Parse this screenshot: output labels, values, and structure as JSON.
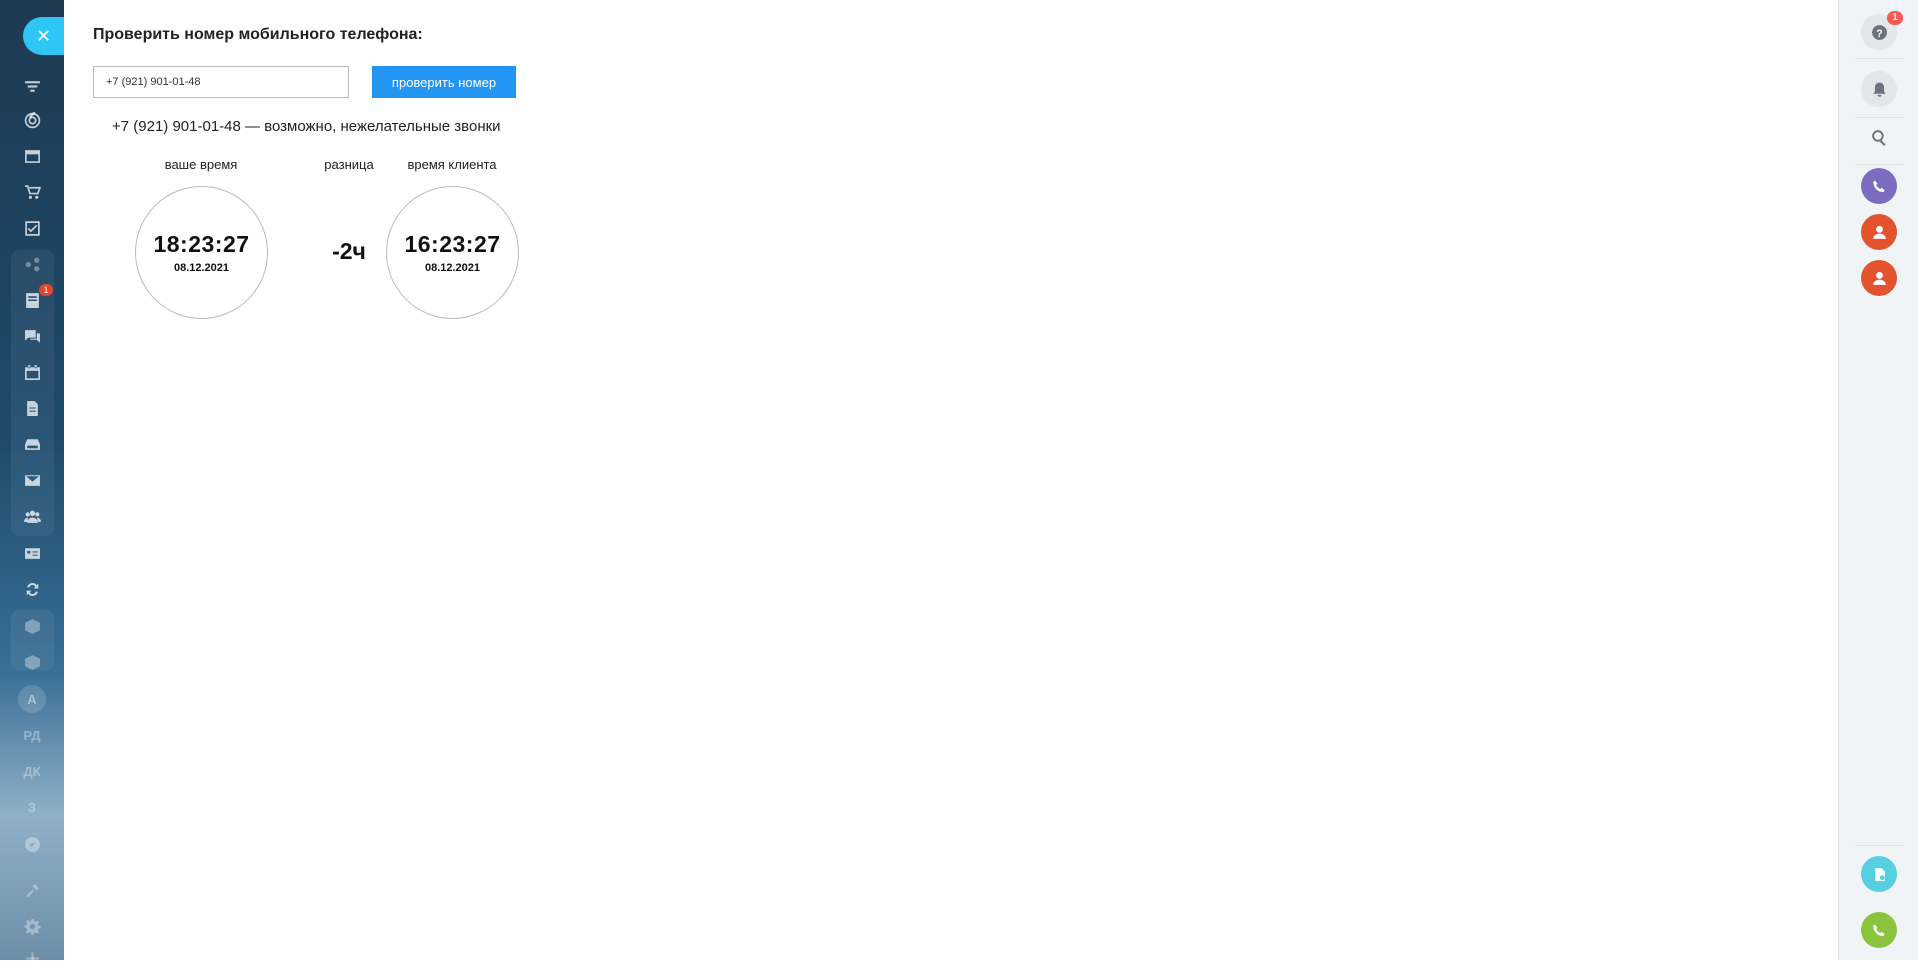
{
  "sidebar": {
    "close_icon": "close-icon",
    "items": [
      {
        "name": "filter-icon"
      },
      {
        "name": "target-icon"
      },
      {
        "name": "window-icon"
      },
      {
        "name": "cart-icon"
      },
      {
        "name": "task-icon"
      },
      {
        "name": "share-icon"
      },
      {
        "name": "feed-icon",
        "badge": "1"
      },
      {
        "name": "chat-icon"
      },
      {
        "name": "calendar-icon"
      },
      {
        "name": "document-icon"
      },
      {
        "name": "drive-icon"
      },
      {
        "name": "mail-icon"
      },
      {
        "name": "group-icon"
      },
      {
        "name": "contact-card-icon"
      },
      {
        "name": "sync-icon"
      },
      {
        "name": "box-icon"
      },
      {
        "name": "box-icon-2"
      },
      {
        "name": "text-a",
        "text": "А"
      },
      {
        "name": "text-rd",
        "text": "РД"
      },
      {
        "name": "text-dk",
        "text": "ДК"
      },
      {
        "name": "text-z",
        "text": "З"
      },
      {
        "name": "check-circle-icon"
      },
      {
        "name": "tools-icon"
      },
      {
        "name": "gear-icon"
      },
      {
        "name": "plus-icon"
      }
    ]
  },
  "main": {
    "title": "Проверить номер мобильного телефона:",
    "phone_value": "+7 (921) 901-01-48",
    "check_button": "проверить номер",
    "result": "+7 (921) 901-01-48 — возможно, нежелательные звонки",
    "your_time_label": "ваше время",
    "diff_label": "разница",
    "client_time_label": "время клиента",
    "your_time": "18:23:27",
    "your_date": "08.12.2021",
    "diff": "-2ч",
    "client_time": "16:23:27",
    "client_date": "08.12.2021"
  },
  "rightbar": {
    "help_badge": "1",
    "colors": {
      "viber": "#7b6cc2",
      "avatar": "#e3532e",
      "phone": "#8ac43c",
      "docs": "#55d0e0"
    }
  }
}
